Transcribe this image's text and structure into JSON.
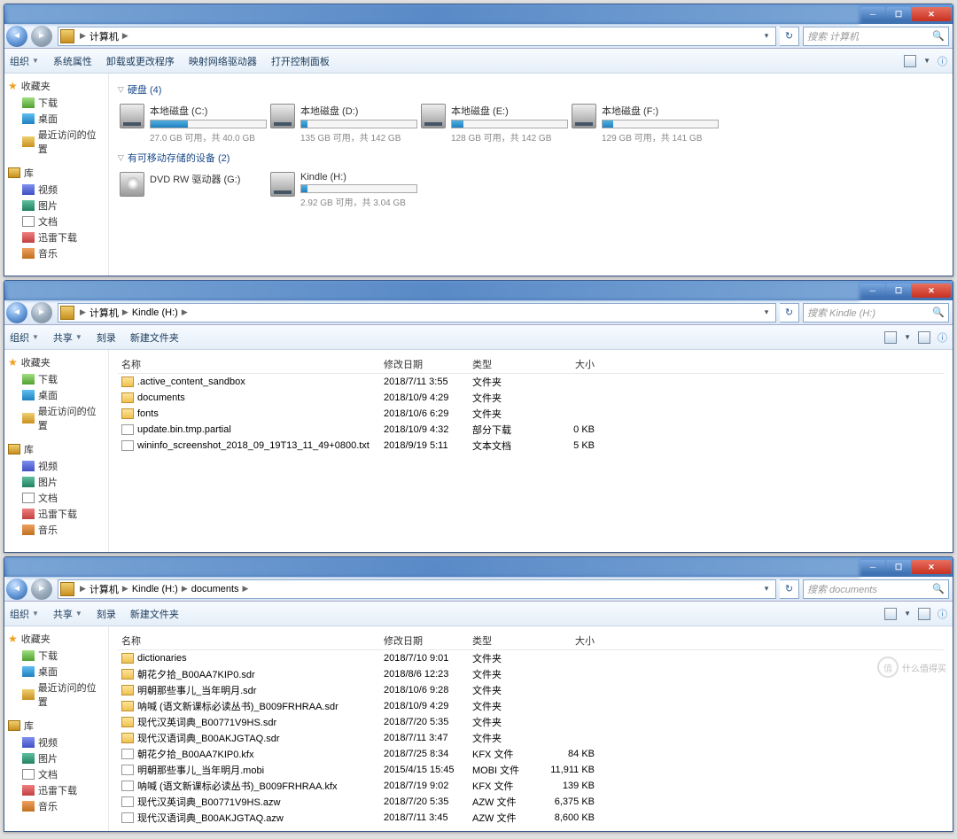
{
  "win1": {
    "breadcrumbs": [
      "计算机"
    ],
    "search_ph": "搜索 计算机",
    "toolbar": [
      "组织",
      "系统属性",
      "卸载或更改程序",
      "映射网络驱动器",
      "打开控制面板"
    ],
    "sect1": "硬盘 (4)",
    "drives": [
      {
        "name": "本地磁盘 (C:)",
        "stat": "27.0 GB 可用，共 40.0 GB",
        "fill": 32
      },
      {
        "name": "本地磁盘 (D:)",
        "stat": "135 GB 可用，共 142 GB",
        "fill": 5
      },
      {
        "name": "本地磁盘 (E:)",
        "stat": "128 GB 可用，共 142 GB",
        "fill": 10
      },
      {
        "name": "本地磁盘 (F:)",
        "stat": "129 GB 可用，共 141 GB",
        "fill": 9
      }
    ],
    "sect2": "有可移动存储的设备 (2)",
    "remov": [
      {
        "name": "DVD RW 驱动器 (G:)",
        "stat": "",
        "fill": 0,
        "dvd": true
      },
      {
        "name": "Kindle (H:)",
        "stat": "2.92 GB 可用，共 3.04 GB",
        "fill": 5
      }
    ]
  },
  "win2": {
    "breadcrumbs": [
      "计算机",
      "Kindle (H:)"
    ],
    "search_ph": "搜索 Kindle (H:)",
    "toolbar": [
      "组织",
      "共享",
      "刻录",
      "新建文件夹"
    ],
    "cols": {
      "name": "名称",
      "date": "修改日期",
      "type": "类型",
      "size": "大小"
    },
    "rows": [
      {
        "n": ".active_content_sandbox",
        "d": "2018/7/11 3:55",
        "t": "文件夹",
        "s": "",
        "f": false
      },
      {
        "n": "documents",
        "d": "2018/10/9 4:29",
        "t": "文件夹",
        "s": "",
        "f": false
      },
      {
        "n": "fonts",
        "d": "2018/10/6 6:29",
        "t": "文件夹",
        "s": "",
        "f": false
      },
      {
        "n": "update.bin.tmp.partial",
        "d": "2018/10/9 4:32",
        "t": "部分下载",
        "s": "0 KB",
        "f": true
      },
      {
        "n": "wininfo_screenshot_2018_09_19T13_11_49+0800.txt",
        "d": "2018/9/19 5:11",
        "t": "文本文档",
        "s": "5 KB",
        "f": true
      }
    ]
  },
  "win3": {
    "breadcrumbs": [
      "计算机",
      "Kindle (H:)",
      "documents"
    ],
    "search_ph": "搜索 documents",
    "toolbar": [
      "组织",
      "共享",
      "刻录",
      "新建文件夹"
    ],
    "cols": {
      "name": "名称",
      "date": "修改日期",
      "type": "类型",
      "size": "大小"
    },
    "rows": [
      {
        "n": "dictionaries",
        "d": "2018/7/10 9:01",
        "t": "文件夹",
        "s": "",
        "f": false
      },
      {
        "n": "朝花夕拾_B00AA7KIP0.sdr",
        "d": "2018/8/6 12:23",
        "t": "文件夹",
        "s": "",
        "f": false
      },
      {
        "n": "明朝那些事儿_当年明月.sdr",
        "d": "2018/10/6 9:28",
        "t": "文件夹",
        "s": "",
        "f": false
      },
      {
        "n": "呐喊 (语文新课标必读丛书)_B009FRHRAA.sdr",
        "d": "2018/10/9 4:29",
        "t": "文件夹",
        "s": "",
        "f": false
      },
      {
        "n": "现代汉英词典_B00771V9HS.sdr",
        "d": "2018/7/20 5:35",
        "t": "文件夹",
        "s": "",
        "f": false
      },
      {
        "n": "现代汉语词典_B00AKJGTAQ.sdr",
        "d": "2018/7/11 3:47",
        "t": "文件夹",
        "s": "",
        "f": false
      },
      {
        "n": "朝花夕拾_B00AA7KIP0.kfx",
        "d": "2018/7/25 8:34",
        "t": "KFX 文件",
        "s": "84 KB",
        "f": true
      },
      {
        "n": "明朝那些事儿_当年明月.mobi",
        "d": "2015/4/15 15:45",
        "t": "MOBI 文件",
        "s": "11,911 KB",
        "f": true
      },
      {
        "n": "呐喊 (语文新课标必读丛书)_B009FRHRAA.kfx",
        "d": "2018/7/19 9:02",
        "t": "KFX 文件",
        "s": "139 KB",
        "f": true
      },
      {
        "n": "现代汉英词典_B00771V9HS.azw",
        "d": "2018/7/20 5:35",
        "t": "AZW 文件",
        "s": "6,375 KB",
        "f": true
      },
      {
        "n": "现代汉语词典_B00AKJGTAQ.azw",
        "d": "2018/7/11 3:45",
        "t": "AZW 文件",
        "s": "8,600 KB",
        "f": true
      }
    ]
  },
  "sidebar": {
    "fav": "收藏夹",
    "fav_items": [
      {
        "l": "下载",
        "c": "dl"
      },
      {
        "l": "桌面",
        "c": "dk"
      },
      {
        "l": "最近访问的位置",
        "c": "rc"
      }
    ],
    "lib": "库",
    "lib_items": [
      {
        "l": "视频",
        "c": "vid"
      },
      {
        "l": "图片",
        "c": "img"
      },
      {
        "l": "文档",
        "c": "doc"
      },
      {
        "l": "迅雷下载",
        "c": "th"
      },
      {
        "l": "音乐",
        "c": "mus"
      }
    ]
  },
  "watermark": "什么值得买"
}
